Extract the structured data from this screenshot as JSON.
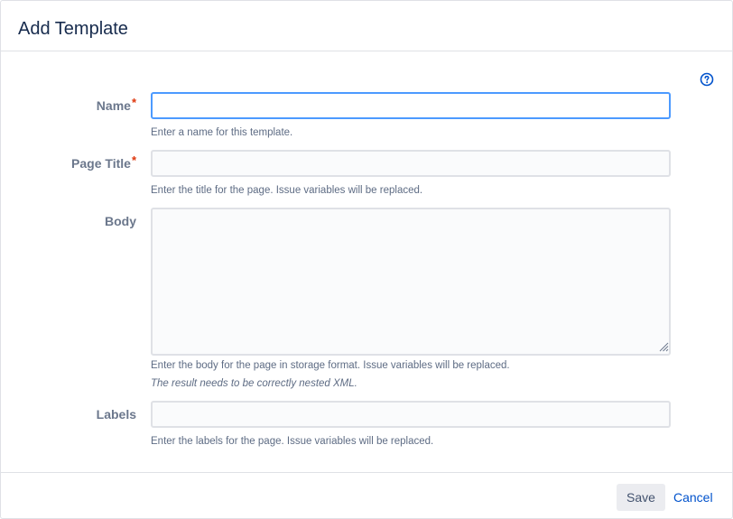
{
  "dialog": {
    "title": "Add Template",
    "help_icon": "help-circle-icon"
  },
  "form": {
    "name": {
      "label": "Name",
      "required_mark": "*",
      "value": "",
      "hint": "Enter a name for this template."
    },
    "page_title": {
      "label": "Page Title",
      "required_mark": "*",
      "value": "",
      "hint": "Enter the title for the page. Issue variables will be replaced."
    },
    "body": {
      "label": "Body",
      "value": "",
      "hint": "Enter the body for the page in storage format. Issue variables will be replaced.",
      "hint_note": "The result needs to be correctly nested XML."
    },
    "labels": {
      "label": "Labels",
      "value": "",
      "hint": "Enter the labels for the page. Issue variables will be replaced."
    }
  },
  "footer": {
    "save_label": "Save",
    "cancel_label": "Cancel"
  },
  "colors": {
    "accent": "#0052cc",
    "focus_border": "#4c9aff",
    "required": "#de350b",
    "label": "#6b778c"
  }
}
